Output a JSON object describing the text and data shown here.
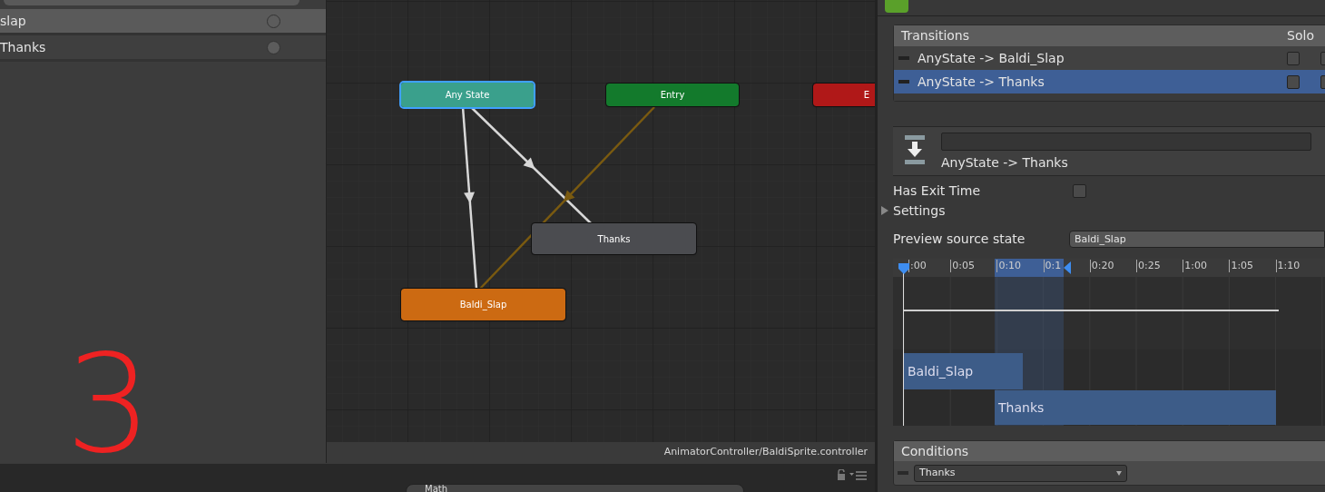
{
  "parameters": [
    {
      "name": "slap",
      "selected": true,
      "on": false
    },
    {
      "name": "Thanks",
      "selected": false,
      "on": false
    }
  ],
  "annotation": "3",
  "graph": {
    "nodes": [
      {
        "label": "Any State",
        "kind": "any_state",
        "selected": true
      },
      {
        "label": "Entry",
        "kind": "entry",
        "selected": false
      },
      {
        "label": "E",
        "kind": "exit",
        "selected": false
      },
      {
        "label": "Thanks",
        "kind": "state",
        "selected": false
      },
      {
        "label": "Baldi_Slap",
        "kind": "default_state",
        "selected": false
      }
    ],
    "path": "AnimatorController/BaldiSprite.controller"
  },
  "bottom_bar": {
    "search_value": "Math"
  },
  "inspector": {
    "transitions": {
      "header": "Transitions",
      "solo_header": "Solo",
      "rows": [
        {
          "label": "AnyState -> Baldi_Slap",
          "selected": false,
          "solo": false,
          "mute": false
        },
        {
          "label": "AnyState -> Thanks",
          "selected": true,
          "solo": false,
          "mute": false
        }
      ]
    },
    "transition_title": "AnyState -> Thanks",
    "has_exit_time": {
      "label": "Has Exit Time",
      "checked": false
    },
    "settings": {
      "label": "Settings",
      "expanded": false
    },
    "preview_source": {
      "label": "Preview source state",
      "value": "Baldi_Slap"
    },
    "timeline": {
      "ticks": [
        ":00",
        "0:05",
        "0:10",
        "0:1",
        "0:20",
        "0:25",
        "1:00",
        "1:05",
        "1:10"
      ],
      "clips": [
        "Baldi_Slap",
        "Thanks"
      ]
    },
    "conditions": {
      "header": "Conditions",
      "rows": [
        {
          "parameter": "Thanks"
        }
      ]
    }
  }
}
